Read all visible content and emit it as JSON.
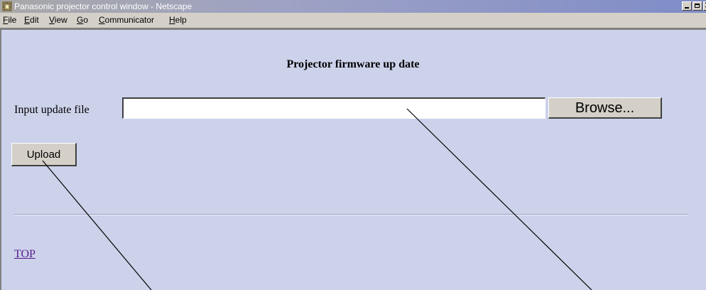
{
  "window": {
    "title": "Panasonic projector control window - Netscape",
    "icon": "netscape-logo-icon"
  },
  "menubar": {
    "items": [
      {
        "label": "File",
        "mnemonic": "F",
        "rest": "ile"
      },
      {
        "label": "Edit",
        "mnemonic": "E",
        "rest": "dit"
      },
      {
        "label": "View",
        "mnemonic": "V",
        "rest": "iew"
      },
      {
        "label": "Go",
        "mnemonic": "G",
        "rest": "o"
      },
      {
        "label": "Communicator",
        "mnemonic": "C",
        "rest": "ommunicator"
      },
      {
        "label": "Help",
        "mnemonic": "H",
        "rest": "elp"
      }
    ]
  },
  "page": {
    "heading": "Projector firmware up date",
    "input_label": "Input update file",
    "file_value": "",
    "browse_label": "Browse...",
    "upload_label": "Upload",
    "top_link": "TOP"
  },
  "colors": {
    "page_background": "#cdd2eb",
    "link": "#551a8b",
    "button_face": "#d4d0c8"
  }
}
